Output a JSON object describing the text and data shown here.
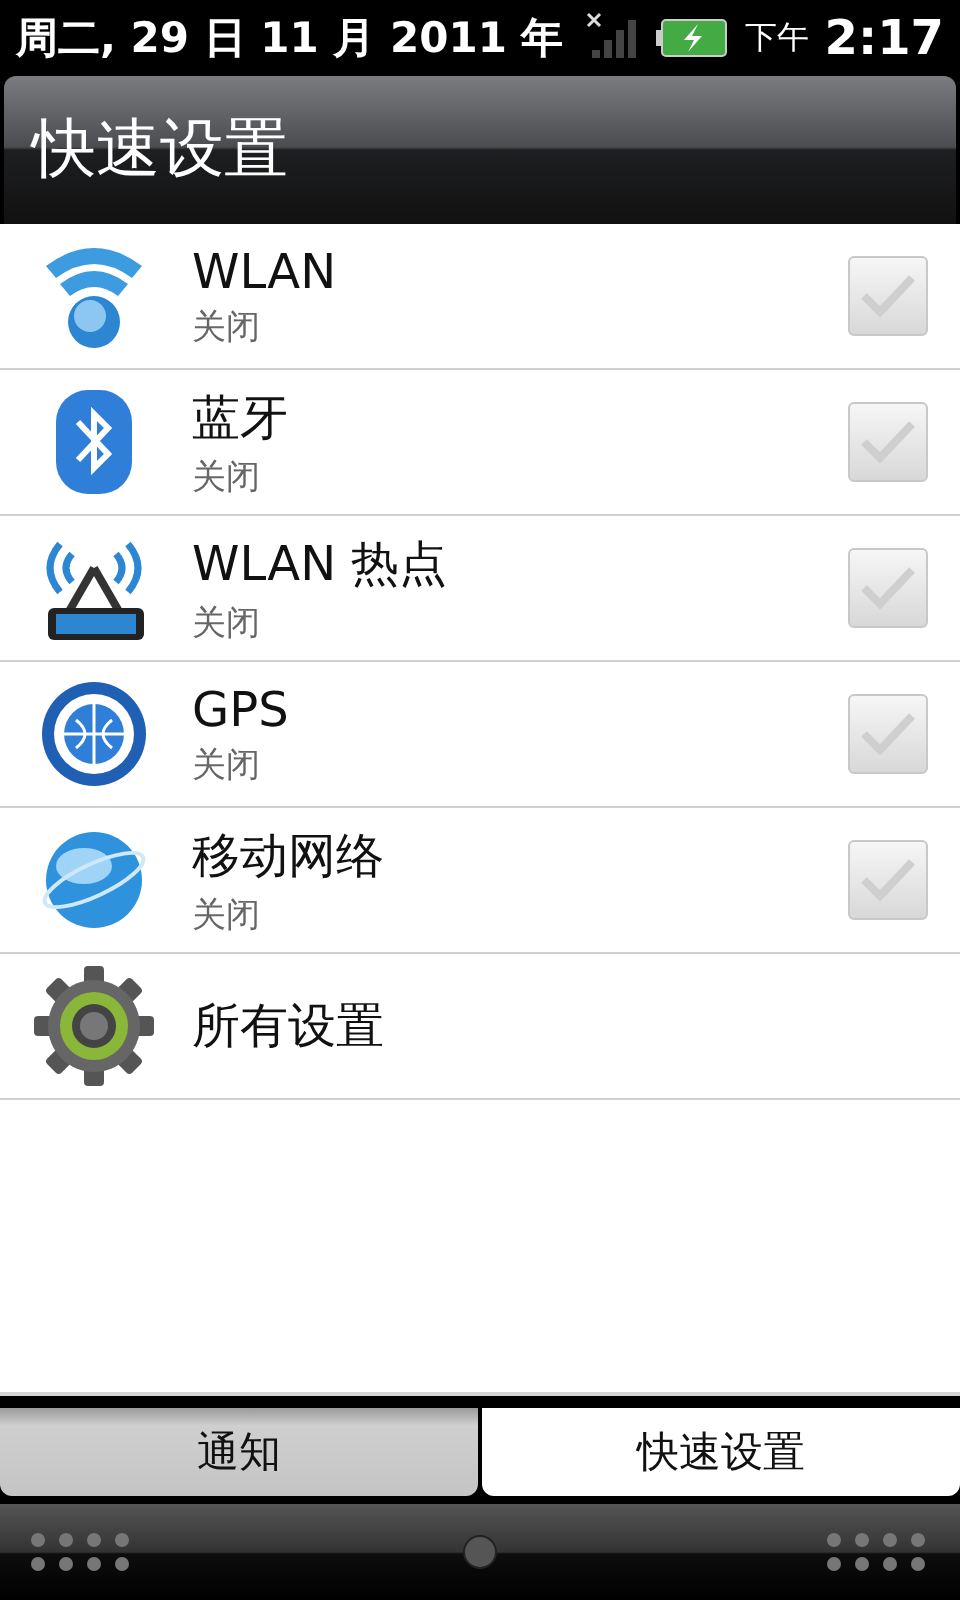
{
  "status_bar": {
    "date": "周二, 29 日 11 月 2011 年",
    "ampm": "下午",
    "time": "2:17"
  },
  "title": "快速设置",
  "items": [
    {
      "kind": "wifi",
      "label": "WLAN",
      "status": "关闭",
      "checked": false
    },
    {
      "kind": "bluetooth",
      "label": "蓝牙",
      "status": "关闭",
      "checked": false
    },
    {
      "kind": "hotspot",
      "label": "WLAN 热点",
      "status": "关闭",
      "checked": false
    },
    {
      "kind": "gps",
      "label": "GPS",
      "status": "关闭",
      "checked": false
    },
    {
      "kind": "mobile",
      "label": "移动网络",
      "status": "关闭",
      "checked": false
    },
    {
      "kind": "settings",
      "label": "所有设置"
    }
  ],
  "tabs": [
    {
      "label": "通知",
      "selected": false
    },
    {
      "label": "快速设置",
      "selected": true
    }
  ]
}
